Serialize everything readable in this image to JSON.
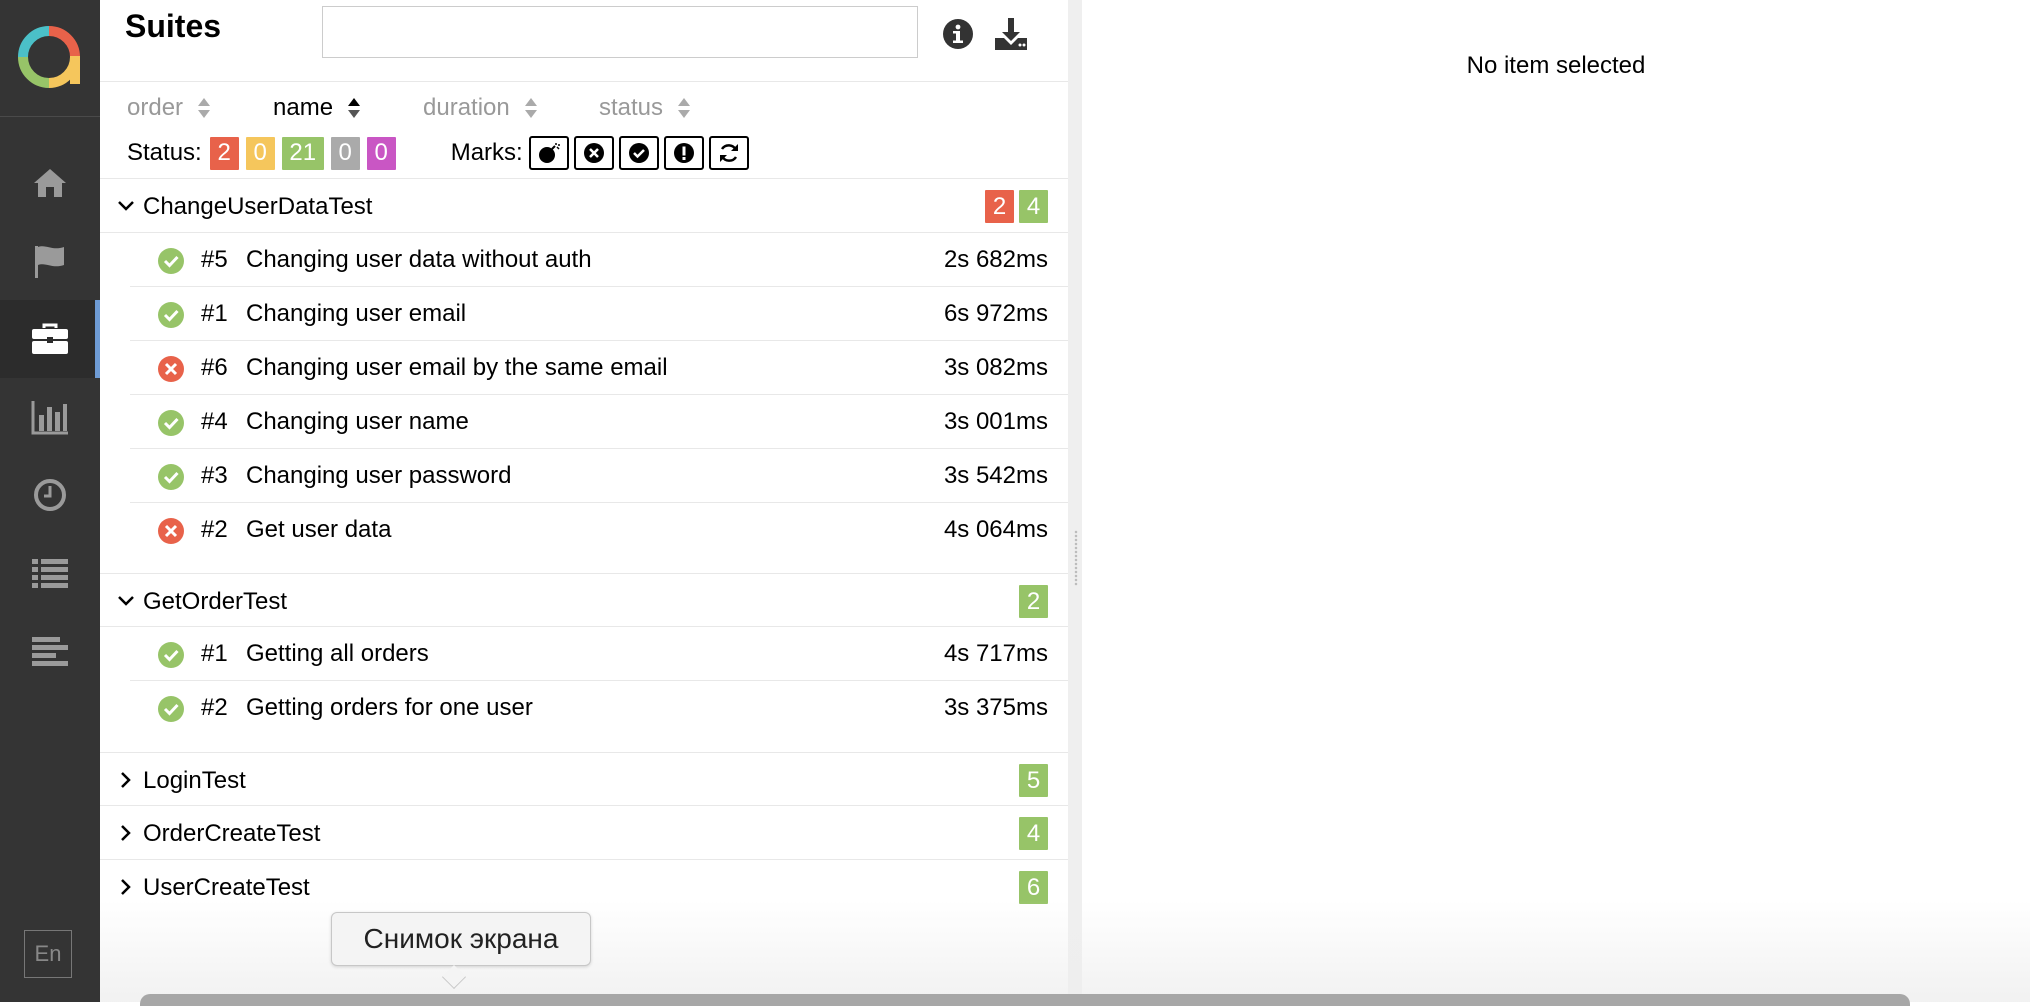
{
  "sidebar": {
    "logo_icon": "allure-logo-icon",
    "items": [
      {
        "name": "overview",
        "icon": "home-icon"
      },
      {
        "name": "categories",
        "icon": "flag-icon"
      },
      {
        "name": "suites",
        "icon": "briefcase-icon",
        "active": true
      },
      {
        "name": "graphs",
        "icon": "bar-chart-icon"
      },
      {
        "name": "timeline",
        "icon": "clock-icon"
      },
      {
        "name": "behaviors",
        "icon": "list-icon"
      },
      {
        "name": "packages",
        "icon": "align-left-icon"
      }
    ],
    "language": "En"
  },
  "suites": {
    "title": "Suites",
    "search_value": "",
    "sort": {
      "order": "order",
      "name": "name",
      "duration": "duration",
      "status": "status"
    },
    "status_label": "Status:",
    "status_counts": {
      "failed": "2",
      "broken": "0",
      "passed": "21",
      "skipped": "0",
      "unknown": "0"
    },
    "marks_label": "Marks:",
    "groups": [
      {
        "name": "ChangeUserDataTest",
        "badges": [
          "2",
          "4"
        ]
      },
      {
        "name": "GetOrderTest",
        "badges": [
          "2"
        ]
      },
      {
        "name": "LoginTest",
        "badges": [
          "5"
        ]
      },
      {
        "name": "OrderCreateTest",
        "badges": [
          "4"
        ]
      },
      {
        "name": "UserCreateTest",
        "badges": [
          "6"
        ]
      }
    ],
    "tests": [
      {
        "num": "#5",
        "name": "Changing user data without auth",
        "duration": "2s 682ms",
        "status": "passed"
      },
      {
        "num": "#1",
        "name": "Changing user email",
        "duration": "6s 972ms",
        "status": "passed"
      },
      {
        "num": "#6",
        "name": "Changing user email by the same email",
        "duration": "3s 082ms",
        "status": "failed"
      },
      {
        "num": "#4",
        "name": "Changing user name",
        "duration": "3s 001ms",
        "status": "passed"
      },
      {
        "num": "#3",
        "name": "Changing user password",
        "duration": "3s 542ms",
        "status": "passed"
      },
      {
        "num": "#2",
        "name": "Get user data",
        "duration": "4s 064ms",
        "status": "failed"
      },
      {
        "num": "#1",
        "name": "Getting all orders",
        "duration": "4s 717ms",
        "status": "passed"
      },
      {
        "num": "#2",
        "name": "Getting orders for one user",
        "duration": "3s 375ms",
        "status": "passed"
      }
    ]
  },
  "details": {
    "empty_text": "No item selected"
  },
  "tooltip": {
    "text": "Снимок экрана"
  },
  "colors": {
    "failed": "#e8624a",
    "broken": "#f5c65c",
    "passed": "#97c468",
    "skipped": "#aaaaaa",
    "unknown": "#c956c4",
    "sidebar": "#343434",
    "active_indicator": "#6e9bd4"
  }
}
